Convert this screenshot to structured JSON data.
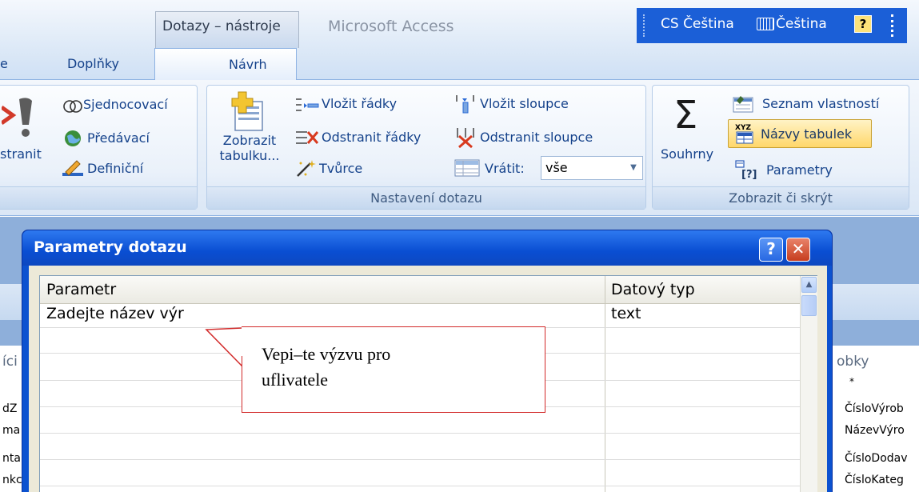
{
  "titlebar": {
    "context_tab": "Dotazy – nástroje",
    "app_title": "Microsoft Access",
    "language_input": "CS Čeština",
    "keyboard_layout": "Čeština",
    "help_glyph": "?"
  },
  "ribbon_tabs": {
    "partial": "e",
    "addins": "Doplňky",
    "design": "Návrh"
  },
  "query_type_group": {
    "partial_big_label": "stranit",
    "union": "Sjednocovací",
    "passthrough": "Předávací",
    "definition": "Definiční"
  },
  "query_setup_group": {
    "label": "Nastavení dotazu",
    "show_table_line1": "Zobrazit",
    "show_table_line2": "tabulku...",
    "insert_rows": "Vložit řádky",
    "delete_rows": "Odstranit řádky",
    "builder": "Tvůrce",
    "insert_columns": "Vložit sloupce",
    "delete_columns": "Odstranit sloupce",
    "return_label": "Vrátit:",
    "return_value": "vše"
  },
  "show_hide_group": {
    "label": "Zobrazit či skrýt",
    "totals": "Souhrny",
    "totals_symbol": "Σ",
    "property_sheet": "Seznam vlastností",
    "table_names": "Názvy tabulek",
    "parameters": "Parametry"
  },
  "background": {
    "left_fragments": [
      "íci",
      "dZ",
      "ma",
      "nta",
      "nkc"
    ],
    "right_title": "obky",
    "right_star": "*",
    "right_fields": [
      "ČísloVýrob",
      "NázevVýro",
      "ČísloDodav",
      "ČísloKateg"
    ]
  },
  "dialog": {
    "title": "Parametry dotazu",
    "help_glyph": "?",
    "close_glyph": "✕",
    "col_param": "Parametr",
    "col_type": "Datový typ",
    "row1_param": "Zadejte název výr",
    "row1_type": "text"
  },
  "callout": {
    "line1": "Vepi–te výzvu pro",
    "line2": "uflivatele"
  },
  "colors": {
    "dialog_blue": "#0c52d0",
    "callout_border": "#d22a2a",
    "language_bar": "#1b5fd7",
    "highlight": "#ffd76a"
  }
}
